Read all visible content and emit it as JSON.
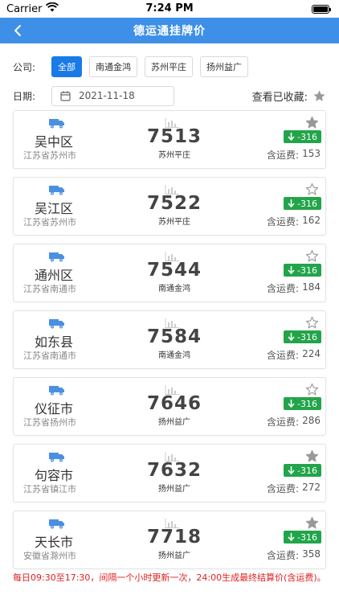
{
  "status": {
    "carrier": "Carrier",
    "time": "7:24 PM"
  },
  "nav": {
    "title": "德运通挂牌价"
  },
  "filter": {
    "company_label": "公司:",
    "chips": [
      {
        "label": "全部",
        "active": true
      },
      {
        "label": "南通金鸿",
        "active": false
      },
      {
        "label": "苏州平庄",
        "active": false
      },
      {
        "label": "扬州益广",
        "active": false
      }
    ],
    "date_label": "日期:",
    "date_value": "2021-11-18",
    "favorites_label": "查看已收藏:"
  },
  "colors": {
    "nav_bg": "#3d8fe8",
    "active_chip": "#1a7ae8",
    "change_bg": "#22a54a",
    "footer_text": "#e02020"
  },
  "cards": [
    {
      "district": "吴中区",
      "province": "江苏省苏州市",
      "price": "7513",
      "company": "苏州平庄",
      "change": "-316",
      "freight_label": "含运费:",
      "freight": "153",
      "starred": true
    },
    {
      "district": "吴江区",
      "province": "江苏省苏州市",
      "price": "7522",
      "company": "苏州平庄",
      "change": "-316",
      "freight_label": "含运费:",
      "freight": "162",
      "starred": false
    },
    {
      "district": "通州区",
      "province": "江苏省南通市",
      "price": "7544",
      "company": "南通金鸿",
      "change": "-316",
      "freight_label": "含运费:",
      "freight": "184",
      "starred": false
    },
    {
      "district": "如东县",
      "province": "江苏省南通市",
      "price": "7584",
      "company": "南通金鸿",
      "change": "-316",
      "freight_label": "含运费:",
      "freight": "224",
      "starred": false
    },
    {
      "district": "仪征市",
      "province": "江苏省扬州市",
      "price": "7646",
      "company": "扬州益广",
      "change": "-316",
      "freight_label": "含运费:",
      "freight": "286",
      "starred": false
    },
    {
      "district": "句容市",
      "province": "江苏省镇江市",
      "price": "7632",
      "company": "扬州益广",
      "change": "-316",
      "freight_label": "含运费:",
      "freight": "272",
      "starred": true
    },
    {
      "district": "天长市",
      "province": "安徽省滁州市",
      "price": "7718",
      "company": "扬州益广",
      "change": "-316",
      "freight_label": "含运费:",
      "freight": "358",
      "starred": true
    }
  ],
  "footer_note": "每日09:30至17:30，间隔一个小时更新一次，24:00生成最终结算价(含运费)。"
}
